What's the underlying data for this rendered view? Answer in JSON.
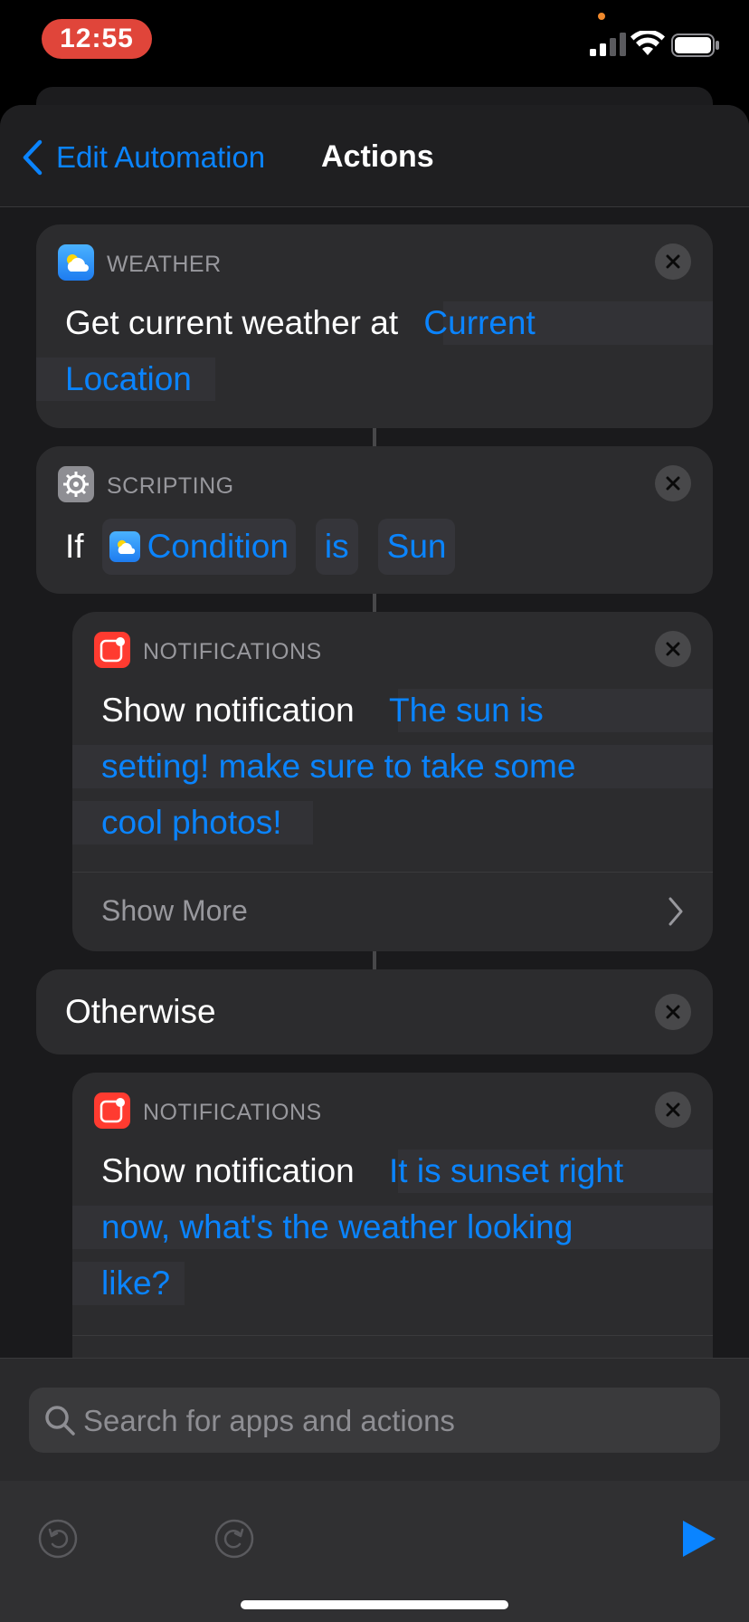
{
  "status_bar": {
    "time": "12:55"
  },
  "nav": {
    "back_label": "Edit Automation",
    "title": "Actions"
  },
  "actions": {
    "weather": {
      "category": "WEATHER",
      "text": "Get current weather at",
      "token": "Current",
      "token2": "Location"
    },
    "if_block": {
      "category": "SCRIPTING",
      "keyword": "If",
      "condition_token": "Condition",
      "operator_token": "is",
      "value_token": "Sun"
    },
    "notification_1": {
      "category": "NOTIFICATIONS",
      "text": "Show notification",
      "message_line1": "The sun is",
      "message_line2": "setting! make sure to take some",
      "message_line3": "cool photos!",
      "show_more": "Show More"
    },
    "otherwise": {
      "label": "Otherwise"
    },
    "notification_2": {
      "category": "NOTIFICATIONS",
      "text": "Show notification",
      "message_line1": "It is sunset right",
      "message_line2": "now, what's the weather looking",
      "message_line3": "like?"
    }
  },
  "search": {
    "placeholder": "Search for apps and actions"
  },
  "colors": {
    "accent": "#0a84ff",
    "card": "#2c2c2e",
    "notification_red": "#ff3b30",
    "time_pill": "#e0453a"
  },
  "icons": [
    "weather-icon",
    "gear-icon",
    "notification-icon",
    "close-icon",
    "search-icon",
    "undo-icon",
    "redo-icon",
    "play-icon",
    "chevron-right-icon",
    "chevron-left-icon"
  ]
}
